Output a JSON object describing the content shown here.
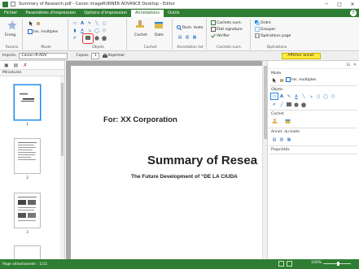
{
  "window": {
    "title": "Summary of Research.pdf - Canon imageRUNNER ADVANCE Desktop - Editor",
    "minimize": "─",
    "maximize": "□",
    "close": "✕"
  },
  "tabs": [
    {
      "label": "Fichier",
      "active": false
    },
    {
      "label": "Paramètres d'impression",
      "active": false
    },
    {
      "label": "Options d'impression",
      "active": false
    },
    {
      "label": "Annotations",
      "active": true
    },
    {
      "label": "Outils",
      "active": false
    }
  ],
  "help_label": "?",
  "ribbon": {
    "favoris": {
      "label": "Favoris",
      "button": "Enreg."
    },
    "mode": {
      "label": "Mode",
      "button": "Ins. multiples"
    },
    "objets": {
      "label": "Objets"
    },
    "cachet": {
      "label": "Cachet",
      "cachet_btn": "Cachet",
      "date_btn": "Date"
    },
    "annotation_txt": {
      "label": "Annotation txt",
      "button": "Rech. texte"
    },
    "cachets_num": {
      "label": "Cachets num.",
      "items": [
        "Cachets num.",
        "État signature",
        "Vérifier"
      ]
    },
    "operations": {
      "label": "Opérations",
      "items": [
        "Ordre",
        "Grouper",
        "Opérations page"
      ]
    }
  },
  "toolbar": {
    "printer_label": "Imprim.",
    "printer_value": "Canon iR-ADV",
    "copies_label": "Copies",
    "copies_value": "1",
    "print_button": "Imprimer",
    "afficher_button": "Afficher annot."
  },
  "left_panel": {
    "header": "Miniatures",
    "pages": [
      {
        "num": "1",
        "selected": true
      },
      {
        "num": "2",
        "selected": false
      },
      {
        "num": "3",
        "selected": false
      }
    ]
  },
  "document": {
    "for_line": "For: XX Corporation",
    "title": "Summary of Resea",
    "subtitle": "The Future Development of “DE LA CIUDA"
  },
  "right_panel": {
    "mode_label": "Mode",
    "mode_button": "Ins. multiples",
    "objets_label": "Objets",
    "cachet_label": "Cachet",
    "annot_label": "Annot. du texte",
    "proprietes_label": "Propriétés"
  },
  "status": {
    "page_text": "Page sélectionnée : 1/11",
    "zoom": "100%"
  }
}
